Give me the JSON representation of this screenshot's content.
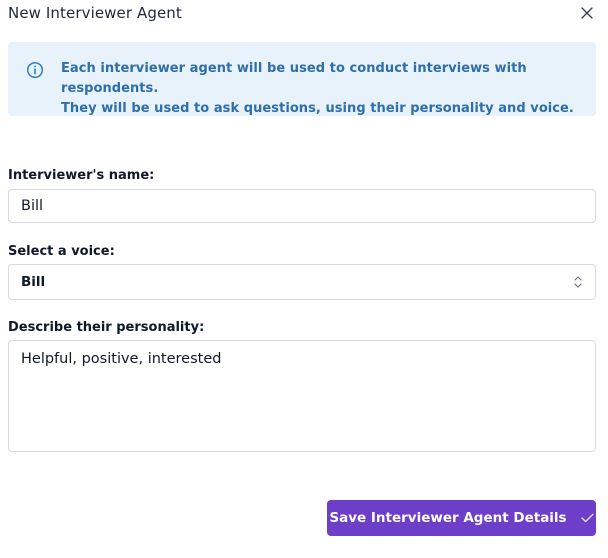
{
  "dialog": {
    "title": "New Interviewer Agent"
  },
  "info": {
    "line1": "Each interviewer agent will be used to conduct interviews with respondents.",
    "line2": "They will be used to ask questions, using their personality and voice."
  },
  "form": {
    "name_label": "Interviewer's name:",
    "name_value": "Bill",
    "voice_label": "Select a voice:",
    "voice_value": "Bill",
    "personality_label": "Describe their personality:",
    "personality_value": "Helpful, positive, interested"
  },
  "actions": {
    "save_label": "Save Interviewer Agent Details"
  },
  "colors": {
    "accent": "#6d3ec8",
    "info_bg": "#e7f2fb",
    "info_text": "#2f6ea8"
  },
  "icons": [
    "close-icon",
    "info-icon",
    "chevron-updown-icon",
    "check-icon"
  ]
}
